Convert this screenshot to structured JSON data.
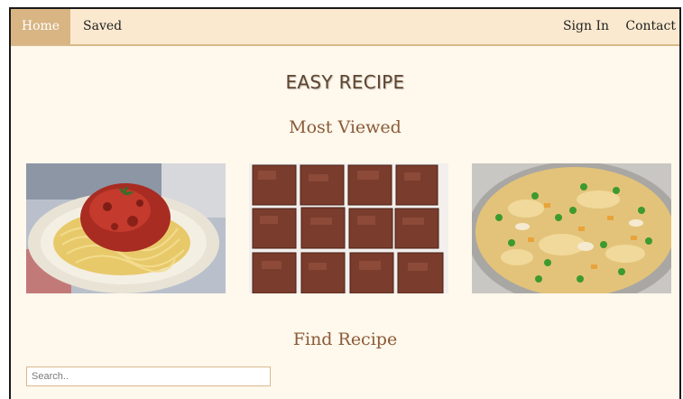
{
  "nav": {
    "home": "Home",
    "saved": "Saved",
    "sign_in": "Sign In",
    "contact": "Contact"
  },
  "site_title": "EASY RECIPE",
  "most_viewed": {
    "title": "Most Viewed",
    "items": [
      {
        "image": "spaghetti-bolognese"
      },
      {
        "image": "brownies"
      },
      {
        "image": "fried-rice"
      }
    ]
  },
  "find_recipe": {
    "title": "Find Recipe",
    "search_placeholder": "Search.."
  },
  "colors": {
    "page_bg": "#fff8ec",
    "nav_bg": "#fbe9cf",
    "nav_active": "#d8b583",
    "heading": "#8a5a38"
  }
}
